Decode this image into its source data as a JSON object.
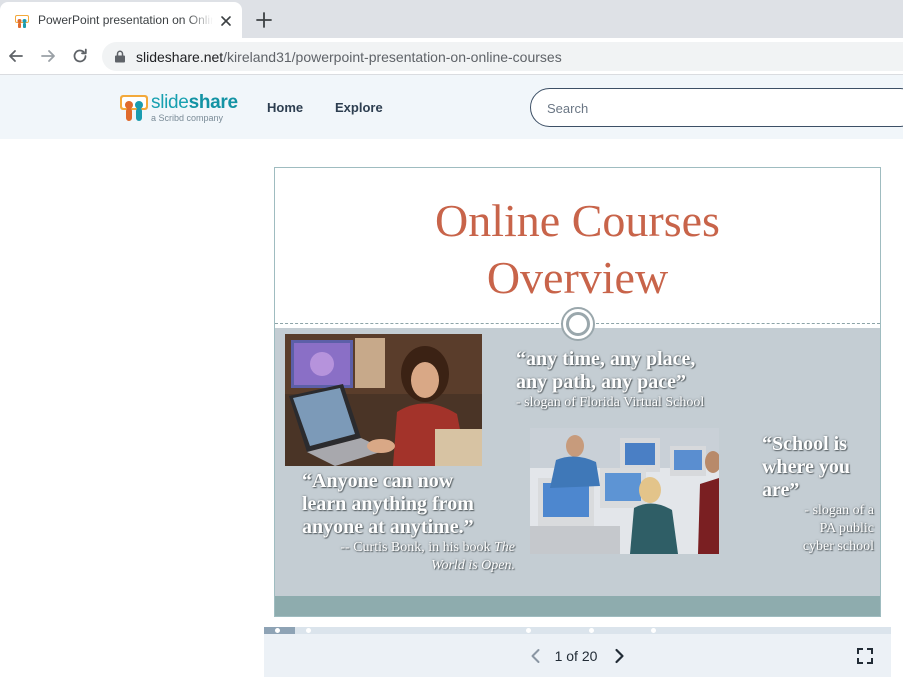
{
  "browser": {
    "tab_title": "PowerPoint presentation on Online Courses",
    "url_host": "slideshare.net",
    "url_path": "/kireland31/powerpoint-presentation-on-online-courses"
  },
  "site": {
    "logo_word_light": "slide",
    "logo_word_bold": "share",
    "logo_sub": "a Scribd company",
    "nav": [
      "Home",
      "Explore"
    ],
    "search_placeholder": "Search"
  },
  "slide": {
    "title_line1": "Online Courses",
    "title_line2": "Overview",
    "quote1_text_line1": "“any time, any place,",
    "quote1_text_line2": "any path, any pace”",
    "quote1_source": "- slogan of Florida Virtual School",
    "quote2_line1": "“Anyone can now",
    "quote2_line2": "learn anything from",
    "quote2_line3": "anyone at anytime.”",
    "quote2_source_prefix": "-- Curtis Bonk, in his book ",
    "quote2_source_book1": "The",
    "quote2_source_book2": "World is Open.",
    "quote3_line1": "“School is",
    "quote3_line2": "where you",
    "quote3_line3": "are”",
    "quote3_source_line1": "- slogan of a",
    "quote3_source_line2": "PA public",
    "quote3_source_line3": "cyber school"
  },
  "player": {
    "current_page": "1",
    "page_of": "of",
    "total_pages": "20",
    "progress_fraction": 0.05
  },
  "colors": {
    "title": "#c8644a",
    "slide_body": "#c4cdd3",
    "slide_footer": "#8eacae",
    "logo": "#18a0b0"
  }
}
